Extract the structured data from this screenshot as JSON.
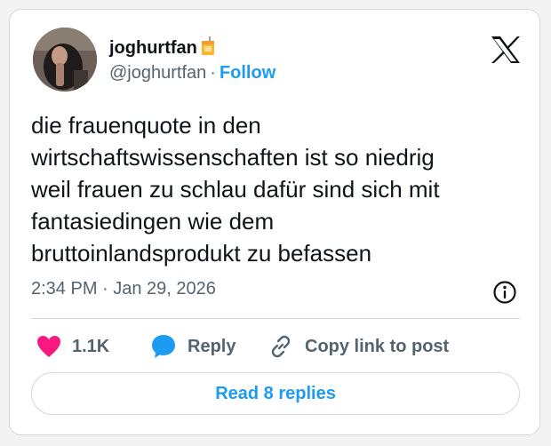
{
  "author": {
    "display_name": "joghurtfan",
    "handle": "@joghurtfan",
    "separator": "·",
    "follow_label": "Follow",
    "badge_icon": "juice-box-icon"
  },
  "tweet": {
    "lines": [
      "die frauenquote in den",
      "wirtschaftswissenschaften ist so niedrig",
      "weil frauen zu schlau dafür sind sich mit",
      "fantasiedingen wie dem",
      "bruttoinlandsprodukt zu befassen"
    ],
    "timestamp": "2:34 PM · Jan 29, 2026"
  },
  "actions": {
    "likes": "1.1K",
    "reply_label": "Reply",
    "copy_label": "Copy link to post"
  },
  "footer": {
    "read_replies_label": "Read 8 replies"
  },
  "colors": {
    "accent": "#1d9bf0",
    "like": "#f91880",
    "text": "#0f1419",
    "muted": "#536471",
    "border": "#cfd9de"
  }
}
